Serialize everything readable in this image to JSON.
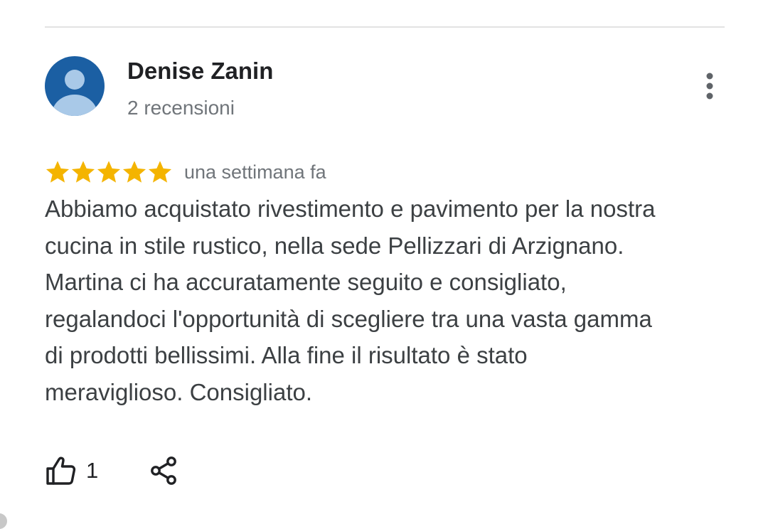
{
  "review": {
    "author": {
      "name": "Denise Zanin",
      "reviews_count": "2 recensioni",
      "avatar_icon": "person-icon",
      "avatar_color": "#1b5fa3"
    },
    "more_icon": "more-vertical-icon",
    "rating": 5,
    "rating_max": 5,
    "star_color": "#f4b400",
    "date": "una settimana fa",
    "text": "Abbiamo acquistato rivestimento e pavimento per la nostra cucina in stile rustico, nella sede Pellizzari di Arzignano. Martina ci ha accuratamente seguito e consigliato, regalandoci l'opportunità di scegliere tra una vasta gamma di prodotti bellissimi. Alla fine il risultato è stato meraviglioso. Consigliato.",
    "actions": {
      "like_icon": "thumbs-up-icon",
      "like_count": "1",
      "share_icon": "share-icon"
    }
  }
}
